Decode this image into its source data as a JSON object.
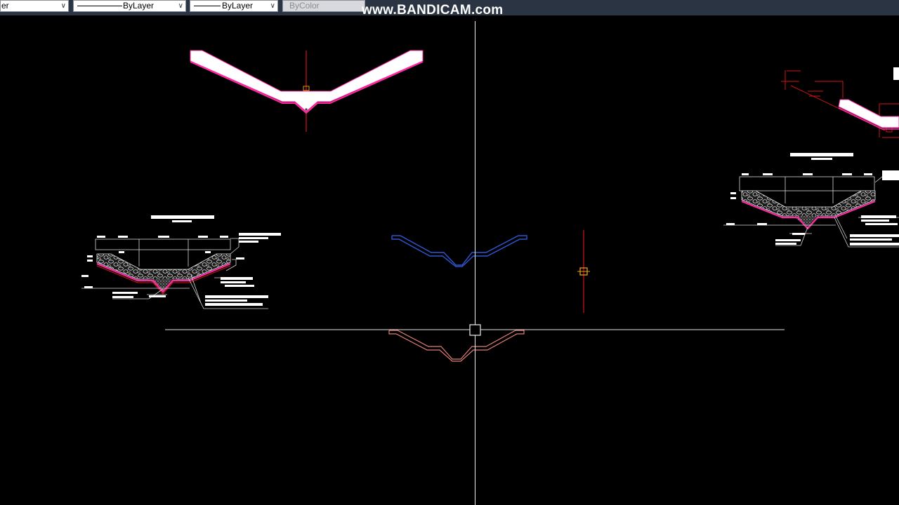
{
  "toolbar": {
    "layer_dropdown": {
      "value": "er"
    },
    "linetype_dropdown": {
      "value": "ByLayer"
    },
    "lineweight_dropdown": {
      "value": "ByLayer"
    },
    "plotstyle_dropdown": {
      "value": "ByColor"
    }
  },
  "watermark": {
    "text": "www.BANDICAM.com"
  },
  "colors": {
    "background": "#000000",
    "toolbar": "#2b3442",
    "crosshair": "#ffffff",
    "centerline": "#d01515",
    "highlight": "#ff2aa3",
    "preview_blue": "#2f56d0",
    "preview_salmon": "#e07e74",
    "snap_marker": "#e69a14"
  },
  "icons": {
    "dropdown_arrow": "chevron-down-icon",
    "cursor": "crosshair-pickbox-icon",
    "snap": "center-snap-marker-icon"
  }
}
